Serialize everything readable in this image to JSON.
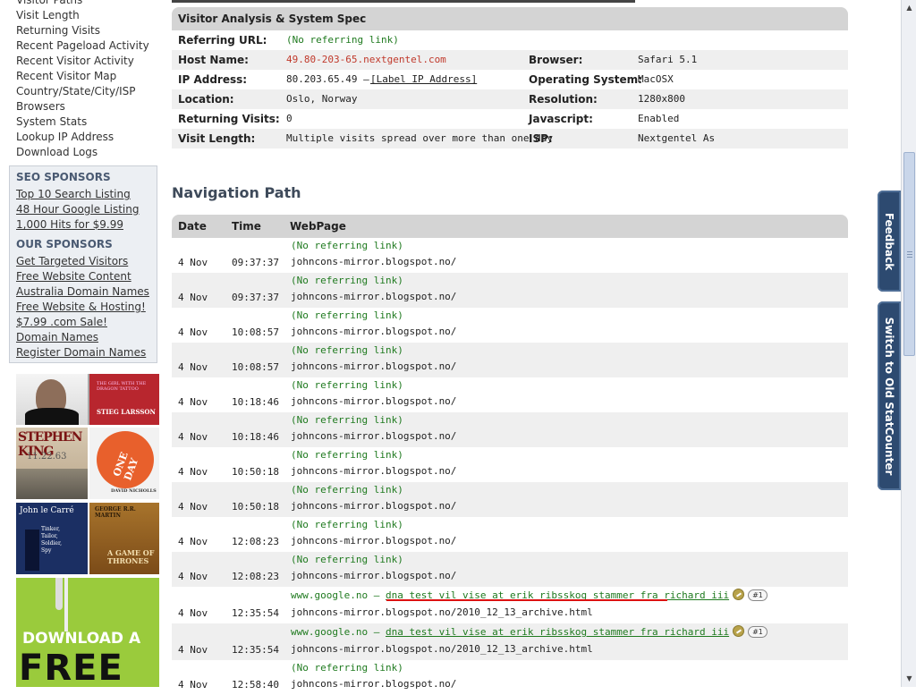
{
  "sidebar": {
    "nav_items": [
      "Visitor Paths",
      "Visit Length",
      "Returning Visits",
      "Recent Pageload Activity",
      "Recent Visitor Activity",
      "Recent Visitor Map",
      "Country/State/City/ISP",
      "Browsers",
      "System Stats",
      "Lookup IP Address",
      "Download Logs"
    ],
    "seo_heading": "SEO SPONSORS",
    "seo_links": [
      "Top 10 Search Listing",
      "48 Hour Google Listing",
      "1,000 Hits for $9.99"
    ],
    "our_heading": "OUR SPONSORS",
    "our_links": [
      "Get Targeted Visitors",
      "Free Website Content",
      "Australia Domain Names",
      "Free Website & Hosting!",
      "$7.99 .com Sale!",
      "Domain Names",
      "Register Domain Names"
    ],
    "books": {
      "dragon_title": "THE GIRL WITH THE DRAGON TATTOO",
      "dragon_author": "STIEG LARSSON",
      "king_author": "STEPHEN KING",
      "king_title": "11.22.63",
      "oneday_title": "ONE DAY",
      "oneday_author": "DAVID NICHOLLS",
      "lecarre_author": "John le Carré",
      "lecarre_title": "Tinker, Tailor, Soldier, Spy",
      "martin_author": "GEORGE R.R. MARTIN",
      "martin_title": "A GAME OF THRONES",
      "ad_line1": "DOWNLOAD A",
      "ad_line2": "FREE"
    }
  },
  "spec": {
    "header": "Visitor Analysis & System Spec",
    "referring_url_label": "Referring URL:",
    "referring_url_value": "(No referring link)",
    "host_label": "Host Name:",
    "host_value": "49.80-203-65.nextgentel.com",
    "browser_label": "Browser:",
    "browser_value": "Safari 5.1",
    "ip_label": "IP Address:",
    "ip_value": "80.203.65.49 —",
    "ip_link": "[Label IP Address]",
    "os_label": "Operating System:",
    "os_value": "MacOSX",
    "location_label": "Location:",
    "location_value": "Oslo, Norway",
    "resolution_label": "Resolution:",
    "resolution_value": "1280x800",
    "returning_label": "Returning Visits:",
    "returning_value": "0",
    "js_label": "Javascript:",
    "js_value": "Enabled",
    "length_label": "Visit Length:",
    "length_value": "Multiple visits spread over more than one day",
    "isp_label": "ISP:",
    "isp_value": "Nextgentel As"
  },
  "navigation": {
    "title": "Navigation Path",
    "columns": [
      "Date",
      "Time",
      "WebPage"
    ],
    "rows": [
      {
        "date": "4 Nov",
        "time": "09:37:37",
        "ref": "(No referring link)",
        "page": "johncons-mirror.blogspot.no/"
      },
      {
        "date": "4 Nov",
        "time": "09:37:37",
        "ref": "(No referring link)",
        "page": "johncons-mirror.blogspot.no/"
      },
      {
        "date": "4 Nov",
        "time": "10:08:57",
        "ref": "(No referring link)",
        "page": "johncons-mirror.blogspot.no/"
      },
      {
        "date": "4 Nov",
        "time": "10:08:57",
        "ref": "(No referring link)",
        "page": "johncons-mirror.blogspot.no/"
      },
      {
        "date": "4 Nov",
        "time": "10:18:46",
        "ref": "(No referring link)",
        "page": "johncons-mirror.blogspot.no/"
      },
      {
        "date": "4 Nov",
        "time": "10:18:46",
        "ref": "(No referring link)",
        "page": "johncons-mirror.blogspot.no/"
      },
      {
        "date": "4 Nov",
        "time": "10:50:18",
        "ref": "(No referring link)",
        "page": "johncons-mirror.blogspot.no/"
      },
      {
        "date": "4 Nov",
        "time": "10:50:18",
        "ref": "(No referring link)",
        "page": "johncons-mirror.blogspot.no/"
      },
      {
        "date": "4 Nov",
        "time": "12:08:23",
        "ref": "(No referring link)",
        "page": "johncons-mirror.blogspot.no/"
      },
      {
        "date": "4 Nov",
        "time": "12:08:23",
        "ref": "(No referring link)",
        "page": "johncons-mirror.blogspot.no/"
      },
      {
        "date": "4 Nov",
        "time": "12:35:54",
        "ref_site": "www.google.no —",
        "ref_query": "dna test vil vise at erik ribsskog stammer fra richard iii",
        "rank": "#1",
        "page": "johncons-mirror.blogspot.no/2010_12_13_archive.html"
      },
      {
        "date": "4 Nov",
        "time": "12:35:54",
        "ref_site": "www.google.no —",
        "ref_query": "dna test vil vise at erik ribsskog stammer fra richard iii",
        "rank": "#1",
        "page": "johncons-mirror.blogspot.no/2010_12_13_archive.html"
      },
      {
        "date": "4 Nov",
        "time": "12:58:40",
        "ref": "(No referring link)",
        "page": "johncons-mirror.blogspot.no/"
      }
    ]
  },
  "side_tabs": {
    "feedback": "Feedback",
    "old": "Switch to Old StatCounter"
  },
  "colors": {
    "link_green": "#1f7a1f",
    "host_red": "#c0392b",
    "tab_blue": "#2d4a70",
    "highlight_red": "#dd1111"
  }
}
